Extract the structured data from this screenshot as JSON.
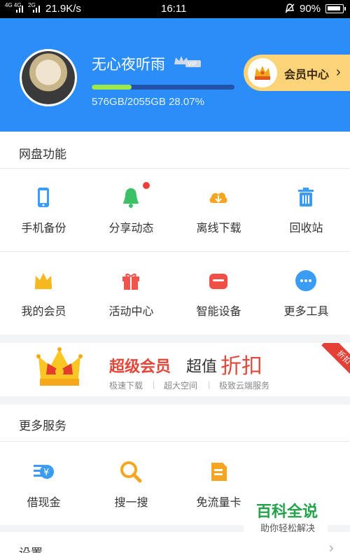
{
  "status_bar": {
    "signal_labels": "4G 4G",
    "signal2_label": "2G",
    "net_speed": "21.9K/s",
    "time": "16:11",
    "battery": "90%"
  },
  "header": {
    "username": "无心夜听雨",
    "vip_badge": "VIP",
    "storage_used_fraction": 0.2807,
    "quota_text": "576GB/2055GB 28.07%",
    "member_center_label": "会员中心",
    "colors": {
      "header_bg": "#2b8df7",
      "progress_fill": "#9be84a",
      "member_btn": "#fbd47a"
    }
  },
  "features": {
    "title": "网盘功能",
    "items": [
      {
        "label": "手机备份",
        "icon": "phone-icon"
      },
      {
        "label": "分享动态",
        "icon": "bell-icon",
        "badge": true
      },
      {
        "label": "离线下载",
        "icon": "cloud-download-icon"
      },
      {
        "label": "回收站",
        "icon": "trash-icon"
      },
      {
        "label": "我的会员",
        "icon": "crown-icon"
      },
      {
        "label": "活动中心",
        "icon": "gift-icon"
      },
      {
        "label": "智能设备",
        "icon": "device-icon"
      },
      {
        "label": "更多工具",
        "icon": "more-icon"
      }
    ]
  },
  "banner": {
    "title": "超级会员",
    "middle": "超值",
    "emphasis": "折扣",
    "tags": [
      "极速下载",
      "超大空间",
      "极致云端服务"
    ],
    "corner_ribbon": "折扣"
  },
  "more_services": {
    "title": "更多服务",
    "items": [
      {
        "label": "借现金",
        "icon": "cash-icon"
      },
      {
        "label": "搜一搜",
        "icon": "search-icon"
      },
      {
        "label": "免流量卡",
        "icon": "sim-card-icon"
      }
    ]
  },
  "settings": {
    "title": "设置"
  },
  "watermark": {
    "title": "百科全说",
    "subtitle": "助你轻松解决"
  }
}
